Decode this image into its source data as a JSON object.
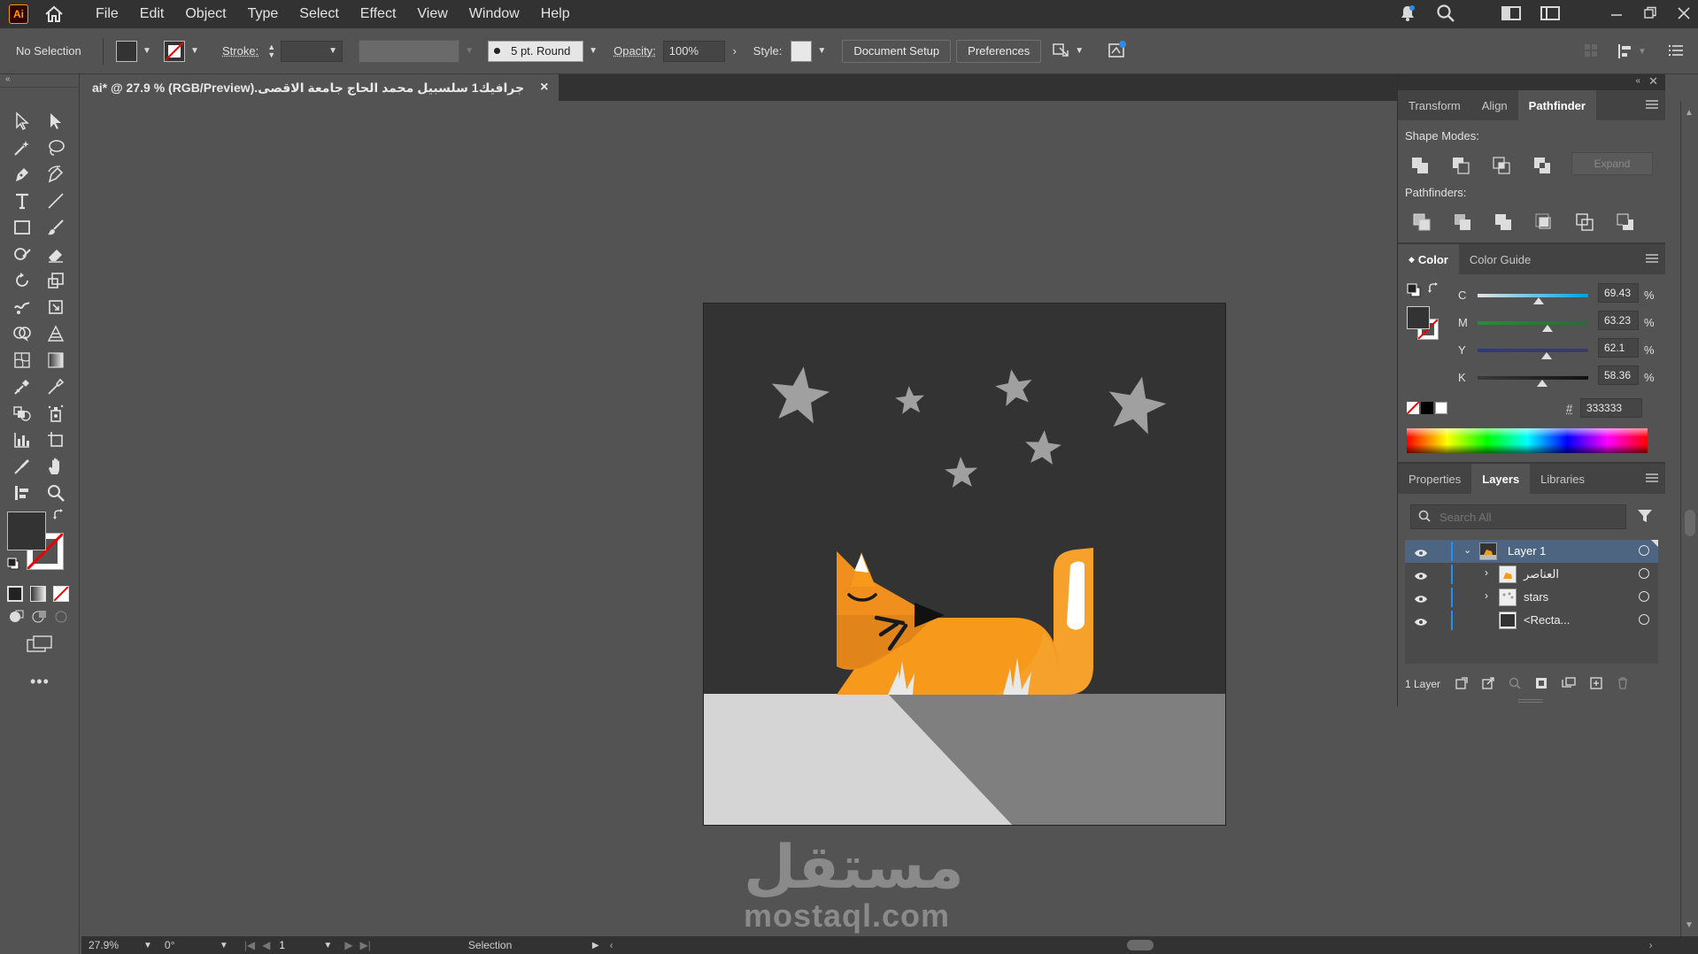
{
  "menubar": {
    "logo": "Ai",
    "items": [
      "File",
      "Edit",
      "Object",
      "Type",
      "Select",
      "Effect",
      "View",
      "Window",
      "Help"
    ]
  },
  "controlbar": {
    "selection": "No Selection",
    "stroke_label": "Stroke:",
    "brush": "5 pt. Round",
    "opacity_label": "Opacity:",
    "opacity_value": "100%",
    "style_label": "Style:",
    "document_setup": "Document Setup",
    "preferences": "Preferences"
  },
  "document": {
    "tab_title": "جرافيك1 سلسبيل محمد الحاج جامعة الاقصى.ai* @ 27.9 % (RGB/Preview)",
    "close": "×"
  },
  "panels": {
    "pathfinder": {
      "tabs": [
        "Transform",
        "Align",
        "Pathfinder"
      ],
      "shape_modes_label": "Shape Modes:",
      "expand_label": "Expand",
      "pathfinders_label": "Pathfinders:"
    },
    "color": {
      "tabs": [
        "Color",
        "Color Guide"
      ],
      "channels": [
        {
          "label": "C",
          "value": "69.43",
          "pct": "%",
          "fraction": 0.5555
        },
        {
          "label": "M",
          "value": "63.23",
          "pct": "%",
          "fraction": 0.6323
        },
        {
          "label": "Y",
          "value": "62.1",
          "pct": "%",
          "fraction": 0.621
        },
        {
          "label": "K",
          "value": "58.36",
          "pct": "%",
          "fraction": 0.5836
        }
      ],
      "hex_label": "#",
      "hex_value": "333333"
    },
    "layers": {
      "tabs": [
        "Properties",
        "Layers",
        "Libraries"
      ],
      "search_placeholder": "Search All",
      "rows": [
        {
          "name": "Layer 1"
        },
        {
          "name": "العناصر"
        },
        {
          "name": "stars"
        },
        {
          "name": "<Recta..."
        }
      ],
      "footer_count": "1 Layer"
    }
  },
  "statusbar": {
    "zoom": "27.9%",
    "rotation": "0°",
    "artboard": "1",
    "tool": "Selection"
  },
  "watermark": {
    "arabic": "مستقل",
    "latin": "mostaql.com"
  },
  "colors": {
    "ui_dark": "#323232",
    "ui_mid": "#535353",
    "artboard_sky": "#333333",
    "fox_orange": "#f79a1b",
    "fox_dark": "#e1851a",
    "ground_light": "#d5d5d5",
    "ground_gray": "#7f7f7f",
    "star": "#a0a0a0"
  }
}
